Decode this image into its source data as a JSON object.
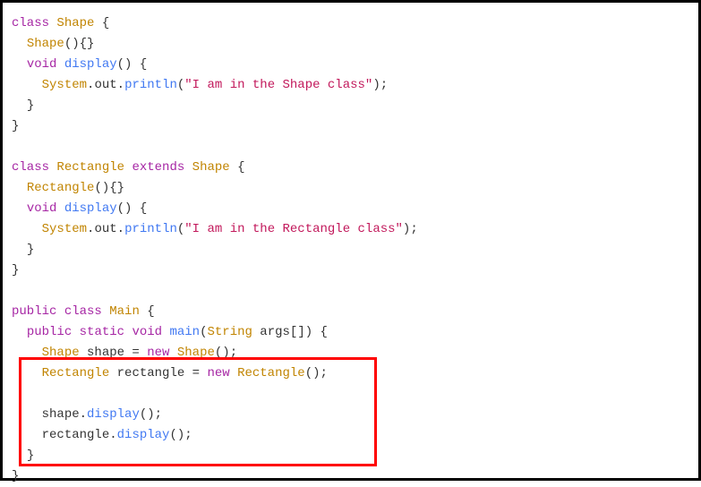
{
  "code": {
    "line1": {
      "kw": "class",
      "name": "Shape",
      "brace": " {"
    },
    "line2": {
      "indent": "  ",
      "ctor": "Shape",
      "parens": "(){}"
    },
    "line3": {
      "indent": "  ",
      "kw": "void",
      "method": " display",
      "rest": "() {"
    },
    "line4": {
      "indent": "    ",
      "obj": "System",
      "dot1": ".",
      "out": "out",
      "dot2": ".",
      "println": "println",
      "open": "(",
      "str": "\"I am in the Shape class\"",
      "close": ");"
    },
    "line5": {
      "indent": "  ",
      "brace": "}"
    },
    "line6": {
      "brace": "}"
    },
    "line7": {
      "blank": " "
    },
    "line8": {
      "kw": "class",
      "name": "Rectangle",
      "ext": " extends",
      "parent": " Shape",
      "brace": " {"
    },
    "line9": {
      "indent": "  ",
      "ctor": "Rectangle",
      "parens": "(){}"
    },
    "line10": {
      "indent": "  ",
      "kw": "void",
      "method": " display",
      "rest": "() {"
    },
    "line11": {
      "indent": "    ",
      "obj": "System",
      "dot1": ".",
      "out": "out",
      "dot2": ".",
      "println": "println",
      "open": "(",
      "str": "\"I am in the Rectangle class\"",
      "close": ");"
    },
    "line12": {
      "indent": "  ",
      "brace": "}"
    },
    "line13": {
      "brace": "}"
    },
    "line14": {
      "blank": " "
    },
    "line15": {
      "pub": "public",
      "cls": " class",
      "name": " Main",
      "brace": " {"
    },
    "line16": {
      "indent": "  ",
      "pub": "public",
      "stat": " static",
      "vd": " void",
      "main": " main",
      "open": "(",
      "type": "String",
      "args": " args[]) {"
    },
    "line17": {
      "indent": "    ",
      "type1": "Shape",
      "var": " shape = ",
      "nw": "new",
      "type2": " Shape",
      "end": "();"
    },
    "line18": {
      "indent": "    ",
      "type1": "Rectangle",
      "var": " rectangle = ",
      "nw": "new",
      "type2": " Rectangle",
      "end": "();"
    },
    "line19": {
      "blank": " "
    },
    "line20": {
      "indent": "    ",
      "obj": "shape",
      "dot": ".",
      "method": "display",
      "end": "();"
    },
    "line21": {
      "indent": "    ",
      "obj": "rectangle",
      "dot": ".",
      "method": "display",
      "end": "();"
    },
    "line22": {
      "indent": "  ",
      "brace": "}"
    },
    "line23": {
      "brace": "}"
    }
  },
  "highlight": {
    "top": "396",
    "left": "18",
    "width": "400",
    "height": "122"
  }
}
